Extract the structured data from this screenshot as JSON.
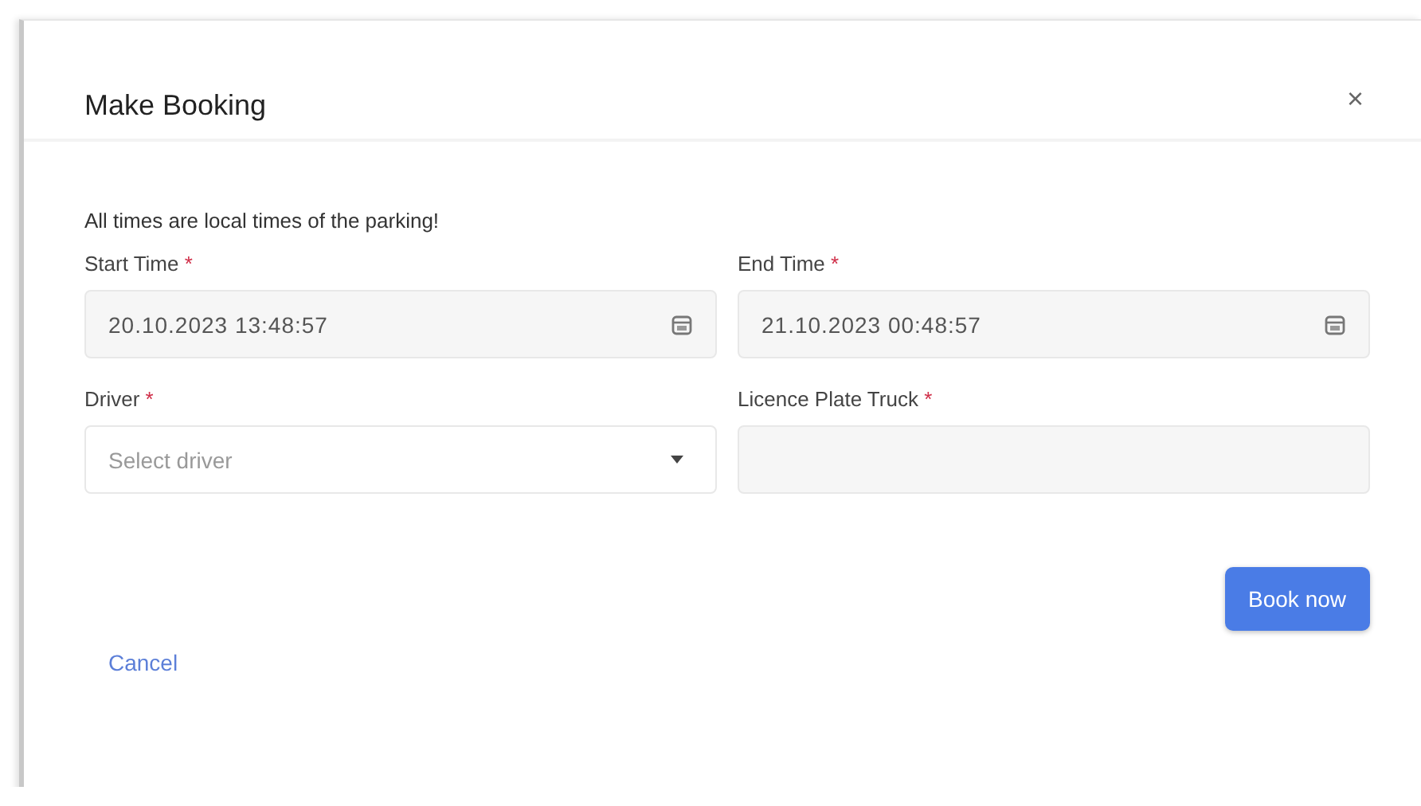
{
  "dialog": {
    "title": "Make Booking",
    "close": "×",
    "notice": "All times are local times of the parking!",
    "fields": [
      {
        "kind": "datetime",
        "label": "Start Time",
        "required_mark": "*",
        "value": "20.10.2023 13:48:57"
      },
      {
        "kind": "datetime",
        "label": "End Time",
        "required_mark": "*",
        "value": "21.10.2023 00:48:57"
      },
      {
        "kind": "select",
        "label": "Driver",
        "required_mark": "*",
        "placeholder": "Select driver"
      },
      {
        "kind": "text",
        "label": "Licence Plate Truck",
        "required_mark": "*"
      }
    ],
    "primary_button": "Book now",
    "cancel_link": "Cancel"
  }
}
